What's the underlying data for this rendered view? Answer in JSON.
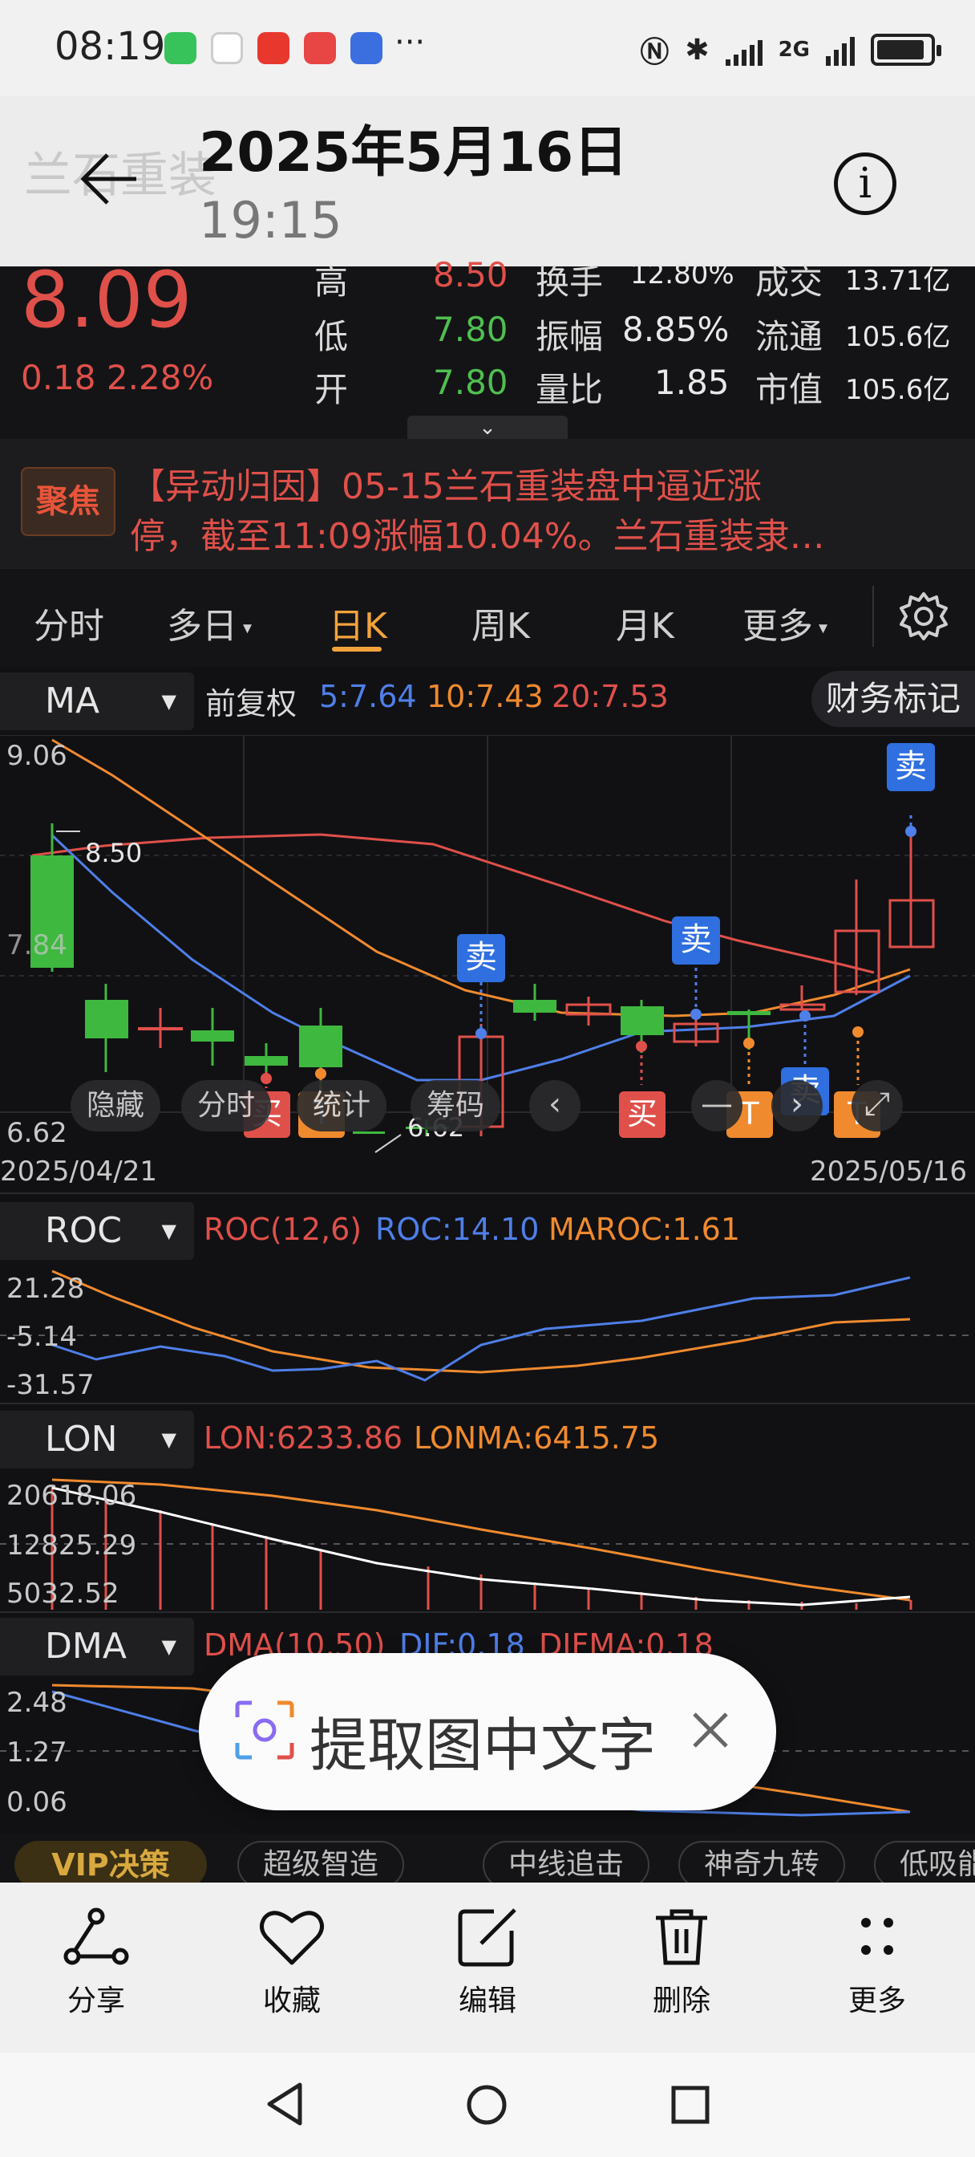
{
  "status_bar": {
    "time": "08:19",
    "network": "2G",
    "more": "···"
  },
  "header": {
    "date_title": "2025年5月16日",
    "time_sub": "19:15",
    "ghost_title": "兰石重装"
  },
  "quote": {
    "price": "8.09",
    "change": "0.18 2.28%",
    "rows": [
      {
        "l1": "高",
        "v1": "8.50",
        "l2": "换手",
        "v2": "12.80%",
        "l3": "成交",
        "v3": "13.71亿"
      },
      {
        "l1": "低",
        "v1": "7.80",
        "l2": "振幅",
        "v2": "8.85%",
        "l3": "流通",
        "v3": "105.6亿"
      },
      {
        "l1": "开",
        "v1": "7.80",
        "l2": "量比",
        "v2": "1.85",
        "l3": "市值",
        "v3": "105.6亿"
      }
    ],
    "expand_chevron": "⌄"
  },
  "news": {
    "tag": "聚焦",
    "line1": "【异动归因】05-15兰石重装盘中逼近涨",
    "line2": "停，截至11:09涨幅10.04%。兰石重装隶…"
  },
  "tabs": [
    "分时",
    "多日",
    "日K",
    "周K",
    "月K",
    "更多"
  ],
  "active_tab": "日K",
  "ma": {
    "label": "MA",
    "adjust": "前复权",
    "ma5": "5:7.64",
    "ma10": "10:7.43",
    "ma20": "20:7.53",
    "finance_mark": "财务标记"
  },
  "main_axis": {
    "top": "9.06",
    "mid": "7.84",
    "bottom": "6.62",
    "high_label": "8.50",
    "low_label": "6.62"
  },
  "dates": {
    "start": "2025/04/21",
    "end": "2025/05/16"
  },
  "chips": {
    "hide": "隐藏",
    "fenshi": "分时",
    "tongji": "统计",
    "chouma": "筹码",
    "left": "‹",
    "minus": "—",
    "right": "›",
    "expand": "⤢"
  },
  "signals": {
    "sell": "卖",
    "buy": "买",
    "t": "T"
  },
  "roc": {
    "label": "ROC",
    "params": "ROC(12,6)",
    "roc": "ROC:14.10",
    "maroc": "MAROC:1.61",
    "axis": [
      "21.28",
      "-5.14",
      "-31.57"
    ]
  },
  "lon": {
    "label": "LON",
    "lon": "LON:6233.86",
    "lonma": "LONMA:6415.75",
    "axis": [
      "20618.06",
      "12825.29",
      "5032.52"
    ]
  },
  "dma": {
    "label": "DMA",
    "params": "DMA(10,50)",
    "dif": "DIF:0.18",
    "difma": "DIFMA:0.18",
    "axis": [
      "2.48",
      "1.27",
      "0.06"
    ]
  },
  "ocr_popup": {
    "text": "提取图中文字"
  },
  "strategy_pills": {
    "vip": "VIP决策",
    "p1": "超级智造",
    "p2": "中线追击",
    "p3": "神奇九转",
    "p4": "低吸能"
  },
  "bottom_actions": [
    "分享",
    "收藏",
    "编辑",
    "删除",
    "更多"
  ],
  "colors": {
    "up": "#e0504a",
    "down": "#4fbf4f",
    "ma5": "#4f7fe8",
    "ma10": "#f08a2e",
    "ma20": "#e0504a",
    "accent": "#f2a23b"
  }
}
